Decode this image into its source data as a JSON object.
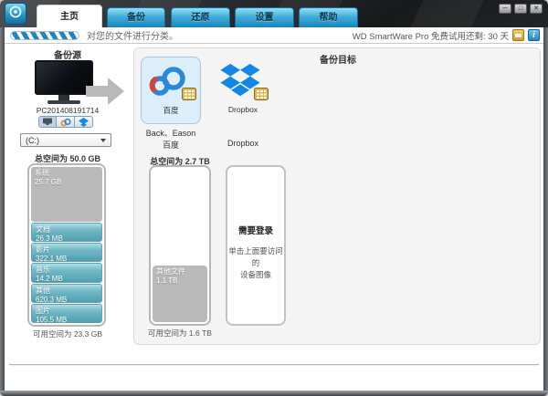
{
  "window": {
    "controls": {
      "minimize": "─",
      "maximize": "□",
      "close": "✕"
    }
  },
  "tabs": [
    {
      "label": "主页"
    },
    {
      "label": "备份"
    },
    {
      "label": "还原"
    },
    {
      "label": "设置"
    },
    {
      "label": "帮助"
    }
  ],
  "banner": {
    "message": "对您的文件进行分类。",
    "trial_text": "WD SmartWare Pro 免费试用还剩: 30 天"
  },
  "source": {
    "title": "备份源",
    "computer_name": "PC201408191714",
    "drive_selected": "(C:)",
    "total_space": "总空间为 50.0 GB",
    "free_space": "可用空间为 23.3 GB",
    "segments": [
      {
        "name": "系统",
        "size": "25.7 GB"
      },
      {
        "name": "文档",
        "size": "26.3 MB"
      },
      {
        "name": "影片",
        "size": "322.1 MB"
      },
      {
        "name": "音乐",
        "size": "14.2 MB"
      },
      {
        "name": "其他",
        "size": "620.3 MB"
      },
      {
        "name": "图片",
        "size": "105.5 MB"
      }
    ]
  },
  "target": {
    "title": "备份目标",
    "devices": [
      {
        "service": "百度",
        "account": "Back、Eason"
      },
      {
        "service": "Dropbox",
        "account": ""
      }
    ],
    "capacity": {
      "total_space": "总空间为 2.7 TB",
      "free_space": "可用空间为 1.6 TB",
      "segment": {
        "name": "其他文件",
        "size": "1.1 TB"
      }
    },
    "login": {
      "title": "需要登录",
      "hint_line1": "单击上面要访问的",
      "hint_line2": "设备图像"
    }
  },
  "colors": {
    "accent_blue": "#1f8fc6",
    "teal_segment": "#5fa9b8",
    "selected_tile_bg": "#dceefb",
    "trial_badge_yellow": "#e9a83c",
    "system_segment_gray": "#b9b9b9"
  }
}
